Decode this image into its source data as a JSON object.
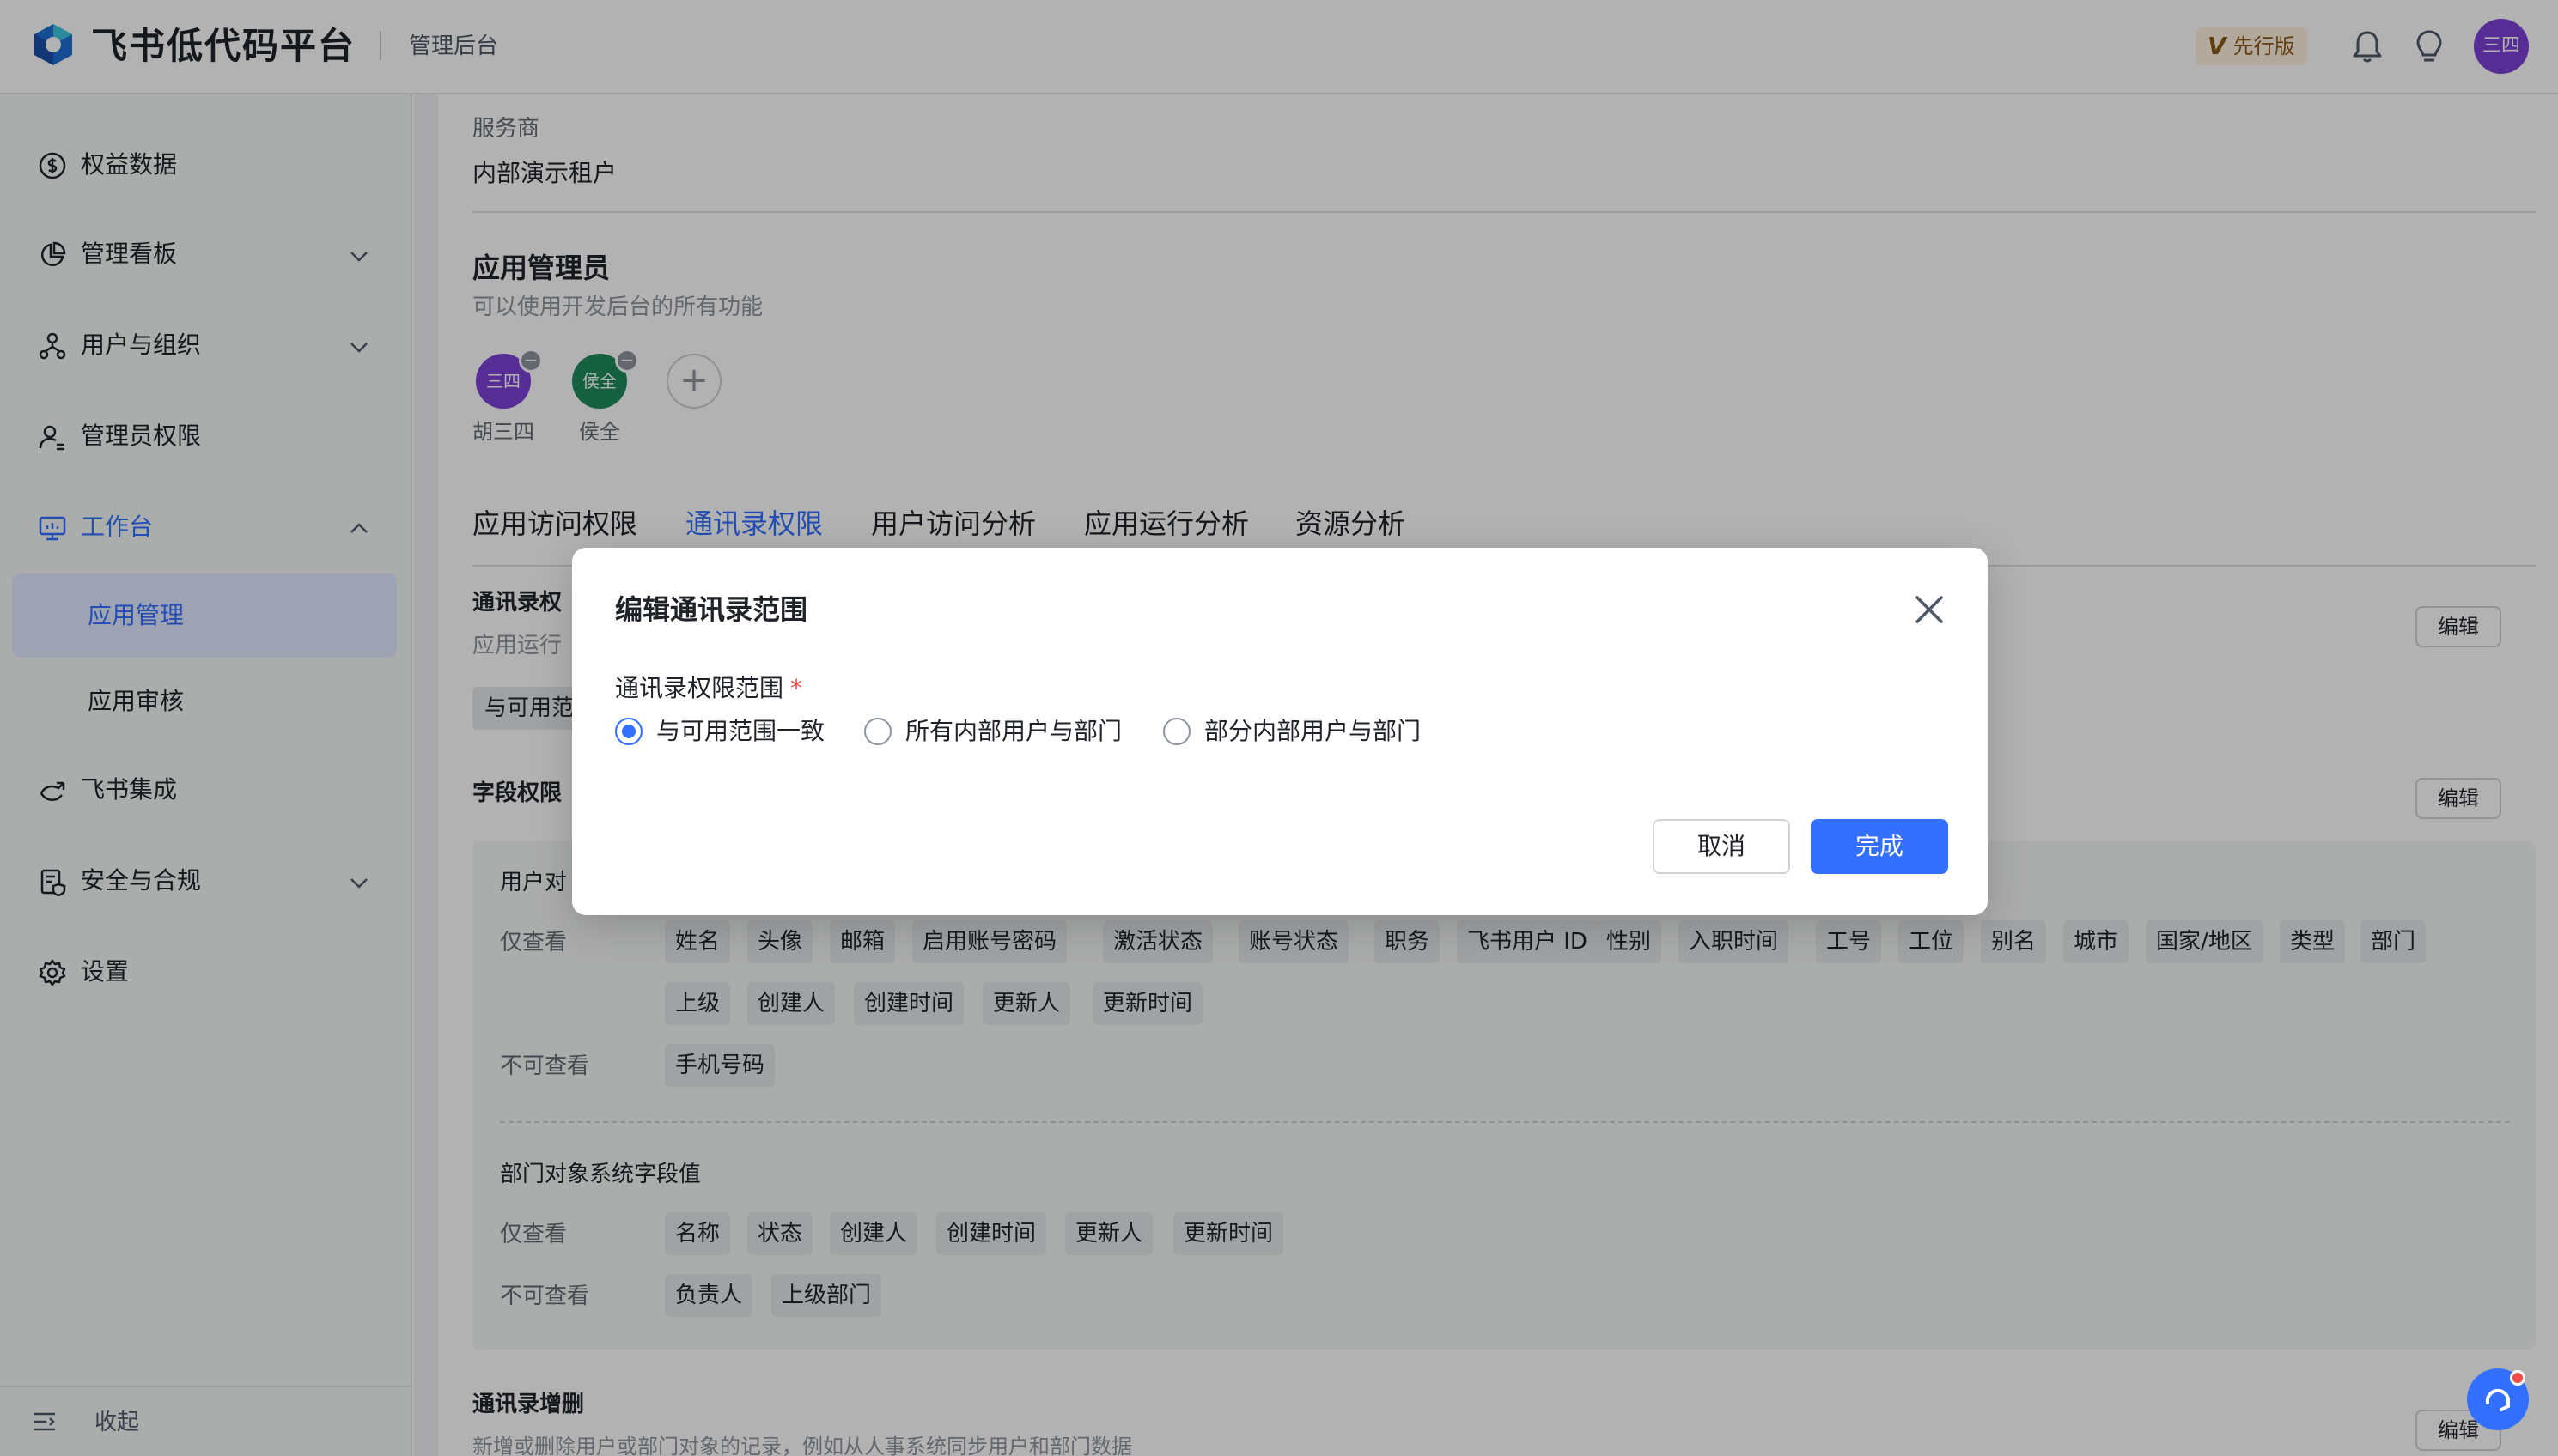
{
  "header": {
    "brand": "飞书低代码平台",
    "subtitle": "管理后台",
    "plan_badge": "先行版",
    "plan_badge_letter": "V",
    "user_avatar": "三四",
    "icons": [
      "logo-icon",
      "bell-icon",
      "lightbulb-icon"
    ]
  },
  "sidebar": {
    "items": [
      {
        "label": "权益数据",
        "icon": "dollar-icon"
      },
      {
        "label": "管理看板",
        "icon": "pie-chart-icon"
      },
      {
        "label": "用户与组织",
        "icon": "org-icon"
      },
      {
        "label": "管理员权限",
        "icon": "admin-user-icon"
      },
      {
        "label": "工作台",
        "icon": "monitor-icon"
      },
      {
        "label": "飞书集成",
        "icon": "integration-icon"
      },
      {
        "label": "安全与合规",
        "icon": "shield-icon"
      },
      {
        "label": "设置",
        "icon": "gear-icon"
      }
    ],
    "sub_items": [
      {
        "label": "应用管理"
      },
      {
        "label": "应用审核"
      }
    ],
    "collapse_label": "收起"
  },
  "content": {
    "provider_label": "服务商",
    "provider_value": "内部演示租户",
    "admins_title": "应用管理员",
    "admins_desc": "可以使用开发后台的所有功能",
    "admins": [
      {
        "avatar": "三四",
        "name": "胡三四",
        "color": "#7b3fd6"
      },
      {
        "avatar": "侯全",
        "name": "侯全",
        "color": "#1f8a5b"
      }
    ],
    "tabs": [
      "应用访问权限",
      "通讯录权限",
      "用户访问分析",
      "应用运行分析",
      "资源分析"
    ],
    "section1_title": "通讯录权",
    "section1_desc": "应用运行",
    "section1_chip": "与可用范",
    "section2_title": "字段权限",
    "user_panel_title": "用户对",
    "edit_label": "编辑",
    "view_only_label": "仅查看",
    "no_view_label": "不可查看",
    "user_view_only_tags": [
      "姓名",
      "头像",
      "邮箱",
      "启用账号密码",
      "激活状态",
      "账号状态",
      "职务",
      "飞书用户 ID",
      "性别",
      "入职时间",
      "工号",
      "工位",
      "别名",
      "城市",
      "国家/地区",
      "类型",
      "部门",
      "上级",
      "创建人",
      "创建时间",
      "更新人",
      "更新时间"
    ],
    "user_no_view_tags": [
      "手机号码"
    ],
    "dept_panel_title": "部门对象系统字段值",
    "dept_view_only_tags": [
      "名称",
      "状态",
      "创建人",
      "创建时间",
      "更新人",
      "更新时间"
    ],
    "dept_no_view_tags": [
      "负责人",
      "上级部门"
    ],
    "section3_title": "通讯录增删",
    "section3_desc": "新增或删除用户或部门对象的记录，例如从人事系统同步用户和部门数据"
  },
  "modal": {
    "title": "编辑通讯录范围",
    "field_label": "通讯录权限范围",
    "required_mark": "*",
    "options": [
      "与可用范围一致",
      "所有内部用户与部门",
      "部分内部用户与部门"
    ],
    "selected_option": "与可用范围一致",
    "cancel_label": "取消",
    "ok_label": "完成"
  },
  "colors": {
    "accent": "#3370ff",
    "required": "#f54a45",
    "mask": "rgba(0,0,0,0.3)"
  }
}
